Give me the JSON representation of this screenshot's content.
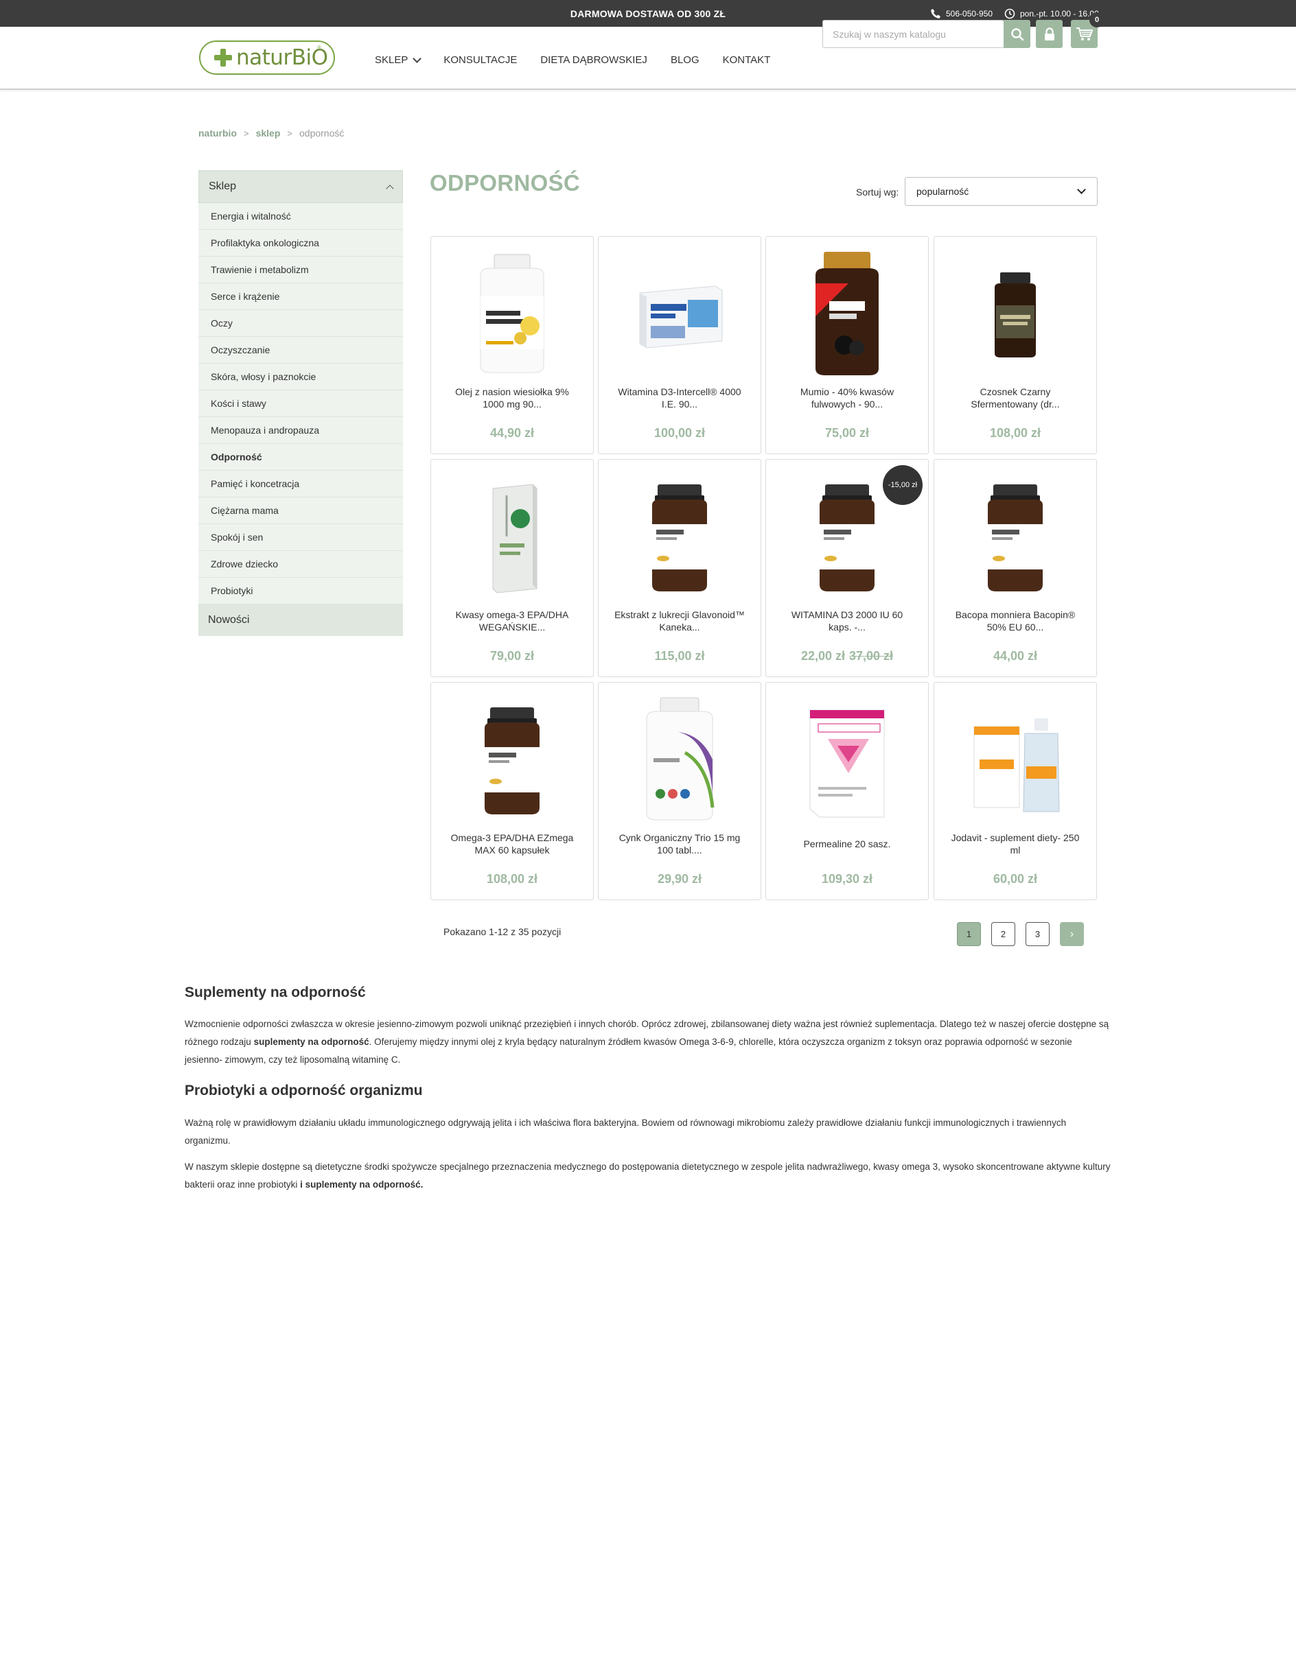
{
  "topbar": {
    "promo": "DARMOWA DOSTAWA OD 300 ZŁ",
    "phone": "506-050-950",
    "hours": "pon.-pt. 10.00 - 16.00"
  },
  "header": {
    "logo_text": "naturBiO",
    "nav": [
      "SKLEP",
      "KONSULTACJE",
      "DIETA DĄBROWSKIEJ",
      "BLOG",
      "KONTAKT"
    ],
    "search_placeholder": "Szukaj w naszym katalogu",
    "cart_count": "0"
  },
  "breadcrumb": {
    "items": [
      "naturbio",
      "sklep"
    ],
    "current": "odporność"
  },
  "sidebar": {
    "title": "Sklep",
    "items": [
      "Energia i witalność",
      "Profilaktyka onkologiczna",
      "Trawienie i metabolizm",
      "Serce i krążenie",
      "Oczy",
      "Oczyszczanie",
      "Skóra, włosy i paznokcie",
      "Kości i stawy",
      "Menopauza i andropauza",
      "Odporność",
      "Pamięć i koncetracja",
      "Ciężarna mama",
      "Spokój i sen",
      "Zdrowe dziecko",
      "Probiotyki"
    ],
    "active_index": 9,
    "bottom": "Nowości"
  },
  "main": {
    "title": "ODPORNOŚĆ",
    "sort_label": "Sortuj wg:",
    "sort_value": "popularność"
  },
  "products": [
    {
      "name": "Olej z nasion wiesiołka 9% 1000 mg 90...",
      "price": "44,90 zł",
      "image": "white-bottle-yellow-label"
    },
    {
      "name": "Witamina D3-Intercell® 4000 I.E. 90...",
      "price": "100,00 zł",
      "image": "box-blue-white"
    },
    {
      "name": "Mumio - 40% kwasów fulwowych - 90...",
      "price": "75,00 zł",
      "image": "dark-jar-gold-lid"
    },
    {
      "name": "Czosnek Czarny Sfermentowany (dr...",
      "price": "108,00 zł",
      "image": "dark-jar-small"
    },
    {
      "name": "Kwasy omega-3 EPA/DHA WEGAŃSKIE...",
      "price": "79,00 zł",
      "image": "grey-box"
    },
    {
      "name": "Ekstrakt z lukrecji Glavonoid™ Kaneka...",
      "price": "115,00 zł",
      "image": "amber-jar"
    },
    {
      "name": "WITAMINA D3 2000 IU 60 kaps. -...",
      "price": "22,00 zł",
      "old_price": "37,00 zł",
      "badge": "-15,00 zł",
      "image": "amber-jar"
    },
    {
      "name": "Bacopa monniera Bacopin® 50% EU 60...",
      "price": "44,00 zł",
      "image": "amber-jar"
    },
    {
      "name": "Omega-3 EPA/DHA EZmega MAX 60 kapsułek",
      "price": "108,00 zł",
      "image": "amber-jar"
    },
    {
      "name": "Cynk Organiczny Trio 15 mg 100 tabl....",
      "price": "29,90 zł",
      "image": "white-bottle-green"
    },
    {
      "name": "Permealine 20 sasz.",
      "price": "109,30 zł",
      "image": "pink-box"
    },
    {
      "name": "Jodavit - suplement diety- 250 ml",
      "price": "60,00 zł",
      "image": "orange-box-bottle"
    }
  ],
  "pagination": {
    "showing": "Pokazano 1-12 z 35 pozycji",
    "pages": [
      "1",
      "2",
      "3"
    ],
    "active": "1",
    "next": "›"
  },
  "description": {
    "h1": "Suplementy na odporność",
    "p1_a": "Wzmocnienie odporności zwłaszcza w okresie jesienno-zimowym pozwoli uniknąć przeziębień i innych chorób. Oprócz zdrowej, zbilansowanej diety ważna jest również suplementacja. Dlatego też w naszej ofercie dostępne są różnego rodzaju ",
    "p1_b": "suplementy na odporność",
    "p1_c": ". Oferujemy między innymi olej z kryla będący naturalnym źródłem kwasów Omega 3-6-9, chlorelle, która oczyszcza organizm z toksyn oraz poprawia odporność w sezonie jesienno- zimowym, czy też liposomalną witaminę C.",
    "h2": "Probiotyki a odporność organizmu",
    "p2": "Ważną rolę w prawidłowym działaniu układu immunologicznego odgrywają jelita i ich właściwa flora bakteryjna. Bowiem od równowagi mikrobiomu zależy prawidłowe działaniu funkcji immunologicznych i trawiennych organizmu.",
    "p3_a": "W naszym sklepie dostępne są dietetyczne środki spożywcze specjalnego przeznaczenia medycznego do postępowania dietetycznego w zespole jelita nadwrażliwego, kwasy omega 3, wysoko skoncentrowane aktywne kultury bakterii oraz inne probiotyki ",
    "p3_b": "i suplementy na odporność."
  },
  "colors": {
    "accent": "#9fb9a1",
    "topbar": "#3d3d3d",
    "logo_green": "#7aa544"
  }
}
